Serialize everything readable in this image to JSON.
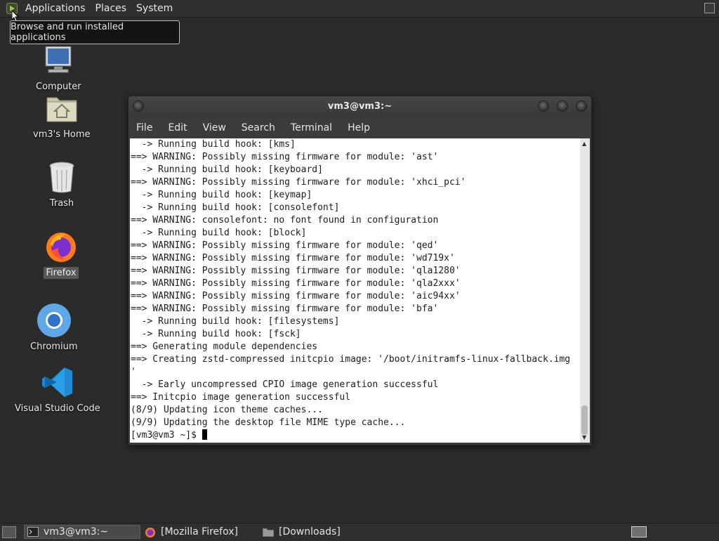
{
  "top_panel": {
    "menus": [
      "Applications",
      "Places",
      "System"
    ]
  },
  "tooltip": {
    "text": "Browse and run installed applications"
  },
  "desktop": {
    "icons": [
      {
        "label": "Computer",
        "icon": "computer-icon"
      },
      {
        "label": "vm3's Home",
        "icon": "home-folder-icon"
      },
      {
        "label": "Trash",
        "icon": "trash-icon"
      },
      {
        "label": "Firefox",
        "icon": "firefox-icon"
      },
      {
        "label": "Chromium",
        "icon": "chromium-icon"
      },
      {
        "label": "Visual Studio Code",
        "icon": "vscode-icon"
      }
    ]
  },
  "terminal": {
    "title": "vm3@vm3:~",
    "menus": [
      "File",
      "Edit",
      "View",
      "Search",
      "Terminal",
      "Help"
    ],
    "lines": [
      "  -> Running build hook: [kms]",
      "==> WARNING: Possibly missing firmware for module: 'ast'",
      "  -> Running build hook: [keyboard]",
      "==> WARNING: Possibly missing firmware for module: 'xhci_pci'",
      "  -> Running build hook: [keymap]",
      "  -> Running build hook: [consolefont]",
      "==> WARNING: consolefont: no font found in configuration",
      "  -> Running build hook: [block]",
      "==> WARNING: Possibly missing firmware for module: 'qed'",
      "==> WARNING: Possibly missing firmware for module: 'wd719x'",
      "==> WARNING: Possibly missing firmware for module: 'qla1280'",
      "==> WARNING: Possibly missing firmware for module: 'qla2xxx'",
      "==> WARNING: Possibly missing firmware for module: 'aic94xx'",
      "==> WARNING: Possibly missing firmware for module: 'bfa'",
      "  -> Running build hook: [filesystems]",
      "  -> Running build hook: [fsck]",
      "==> Generating module dependencies",
      "==> Creating zstd-compressed initcpio image: '/boot/initramfs-linux-fallback.img",
      "'",
      "  -> Early uncompressed CPIO image generation successful",
      "==> Initcpio image generation successful",
      "(8/9) Updating icon theme caches...",
      "(9/9) Updating the desktop file MIME type cache..."
    ],
    "prompt": "[vm3@vm3 ~]$ "
  },
  "taskbar": {
    "tasks": [
      {
        "label": "vm3@vm3:~",
        "icon": "terminal-icon",
        "active": true
      },
      {
        "label": "[Mozilla Firefox]",
        "icon": "firefox-icon",
        "active": false
      },
      {
        "label": "[Downloads]",
        "icon": "folder-icon",
        "active": false
      }
    ]
  }
}
